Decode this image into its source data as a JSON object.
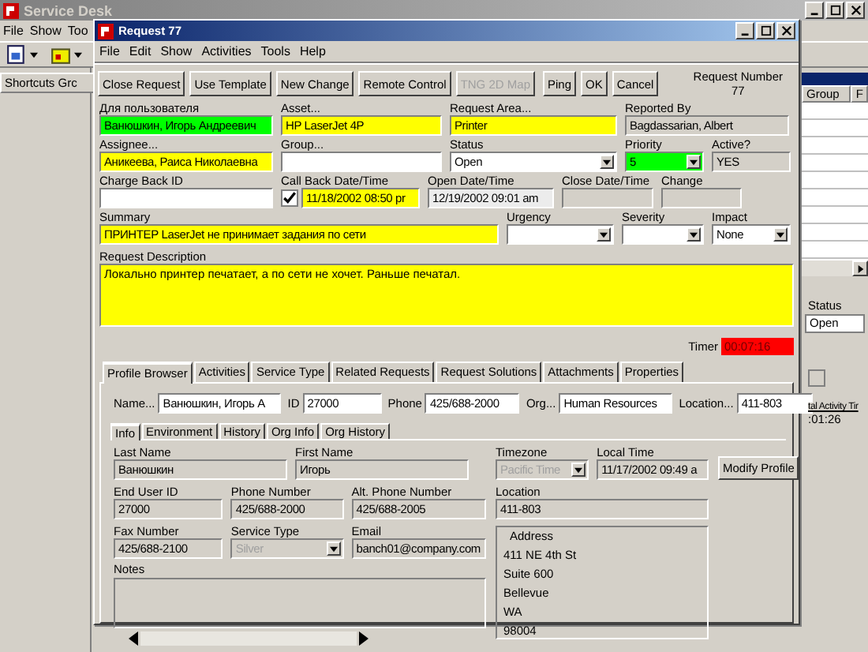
{
  "app": {
    "title": "Service Desk",
    "menu": [
      "File",
      "Show",
      "Too"
    ],
    "shortcuts": "Shortcuts Grc",
    "columns": [
      "Group",
      "F"
    ],
    "status_label": "Status",
    "status_value": "Open",
    "checkbox": {
      "checked": false
    },
    "activity_label": "tal Activity Tir",
    "activity_value": ":01:26"
  },
  "dialog": {
    "title": "Request 77",
    "menu": [
      "File",
      "Edit",
      "Show",
      "Activities",
      "Tools",
      "Help"
    ],
    "toolbar": [
      {
        "label": "Close Request",
        "disabled": false
      },
      {
        "label": "Use Template",
        "disabled": false
      },
      {
        "label": "New Change",
        "disabled": false
      },
      {
        "label": "Remote Control",
        "disabled": false
      },
      {
        "label": "TNG 2D Map",
        "disabled": true
      },
      {
        "label": "Ping",
        "disabled": false
      },
      {
        "label": "OK",
        "disabled": false
      },
      {
        "label": "Cancel",
        "disabled": false
      }
    ],
    "request_number_label": "Request Number",
    "request_number": "77",
    "form": [
      [
        {
          "label": "Для пользователя",
          "value": "Ванюшкин, Игорь Андреевич",
          "kind": "text",
          "color": "#00ff00"
        },
        {
          "label": "Asset...",
          "value": "HP LaserJet 4P",
          "kind": "text",
          "color": "#ffff00"
        },
        {
          "label": "Request Area...",
          "value": "Printer",
          "kind": "text",
          "color": "#ffff00"
        },
        {
          "label": "Reported By",
          "value": "Bagdassarian, Albert",
          "kind": "text",
          "color": "#d4d0c8"
        }
      ],
      [
        {
          "label": "Assignee...",
          "value": "Аникеева, Раиса Николаевна",
          "kind": "text",
          "color": "#ffff00"
        },
        {
          "label": "Group...",
          "kind": "text",
          "color": "#ffffff"
        },
        {
          "label": "Status",
          "value": "Open",
          "kind": "dropdown",
          "color": "#ffffff"
        },
        {
          "label": "Priority",
          "value": "5",
          "kind": "dropdown",
          "color": "#00ff00"
        },
        {
          "label": "Active?",
          "value": "YES",
          "kind": "text",
          "color": "#d4d0c8"
        }
      ],
      [
        {
          "label": "Charge Back ID",
          "kind": "text",
          "color": "#ffffff"
        },
        {
          "label": "Call Back Date/Time",
          "value": "11/18/2002 08:50 pr",
          "kind": "checkdate",
          "checked": true,
          "color": "#ffff00"
        },
        {
          "label": "Open Date/Time",
          "value": "12/19/2002 09:01 am",
          "kind": "text",
          "color": "#ececec"
        },
        {
          "label": "Close Date/Time",
          "kind": "text",
          "color": "#d4d0c8"
        },
        {
          "label": "Change",
          "kind": "text",
          "color": "#d4d0c8"
        }
      ],
      [
        {
          "label": "Summary",
          "value": "ПРИНТЕР LaserJet не принимает задания по сети",
          "kind": "text",
          "color": "#ffff00"
        },
        {
          "label": "Urgency",
          "kind": "dropdown",
          "color": "#ffffff"
        },
        {
          "label": "Severity",
          "kind": "dropdown",
          "color": "#ffffff"
        },
        {
          "label": "Impact",
          "value": "None",
          "kind": "dropdown",
          "color": "#ffffff"
        }
      ]
    ],
    "description_label": "Request Description",
    "description": "Локально принтер печатает, а по сети не хочет. Раньше печатал.",
    "timer_label": "Timer",
    "timer": "00:07:16",
    "tabs": [
      {
        "label": "Profile Browser",
        "selected": true
      },
      {
        "label": "Activities",
        "selected": false
      },
      {
        "label": "Service Type",
        "selected": false
      },
      {
        "label": "Related Requests",
        "selected": false
      },
      {
        "label": "Request Solutions",
        "selected": false
      },
      {
        "label": "Attachments",
        "selected": false
      },
      {
        "label": "Properties",
        "selected": false
      }
    ],
    "profile": {
      "search": [
        {
          "label": "Name...",
          "value": "Ванюшкин, Игорь А"
        },
        {
          "label": "ID",
          "value": "27000"
        },
        {
          "label": "Phone",
          "value": "425/688-2000"
        },
        {
          "label": "Org...",
          "value": "Human Resources"
        },
        {
          "label": "Location...",
          "value": "411-803"
        }
      ],
      "subtabs": [
        {
          "label": "Info",
          "selected": true
        },
        {
          "label": "Environment",
          "selected": false
        },
        {
          "label": "History",
          "selected": false
        },
        {
          "label": "Org Info",
          "selected": false
        },
        {
          "label": "Org History",
          "selected": false
        }
      ],
      "left": [
        [
          {
            "label": "Last Name",
            "value": "Ванюшкин",
            "kind": "text",
            "disabled": false
          },
          {
            "label": "First Name",
            "value": "Игорь",
            "kind": "text",
            "disabled": false
          }
        ],
        [
          {
            "label": "End User ID",
            "value": "27000",
            "kind": "text",
            "disabled": false
          },
          {
            "label": "Phone Number",
            "value": "425/688-2000",
            "kind": "text",
            "disabled": false
          },
          {
            "label": "Alt. Phone Number",
            "value": "425/688-2005",
            "kind": "text",
            "disabled": false
          }
        ],
        [
          {
            "label": "Fax Number",
            "value": "425/688-2100",
            "kind": "text",
            "disabled": false
          },
          {
            "label": "Service Type",
            "value": "Silver",
            "kind": "dropdown",
            "disabled": true
          },
          {
            "label": "Email",
            "value": "banch01@company.com",
            "kind": "text",
            "disabled": false
          }
        ]
      ],
      "notes_label": "Notes",
      "right": [
        [
          {
            "label": "Timezone",
            "value": "Pacific Time",
            "kind": "dropdown",
            "disabled": true
          },
          {
            "label": "Local Time",
            "value": "11/17/2002 09:49 a",
            "kind": "text",
            "disabled": false
          }
        ],
        [
          {
            "label": "Location",
            "value": "411-803",
            "kind": "text",
            "disabled": false
          }
        ]
      ],
      "address_label": "Address",
      "address": [
        "411 NE 4th St",
        "Suite 600",
        "Bellevue",
        "WA",
        "98004"
      ],
      "modify_button": "Modify Profile"
    }
  }
}
